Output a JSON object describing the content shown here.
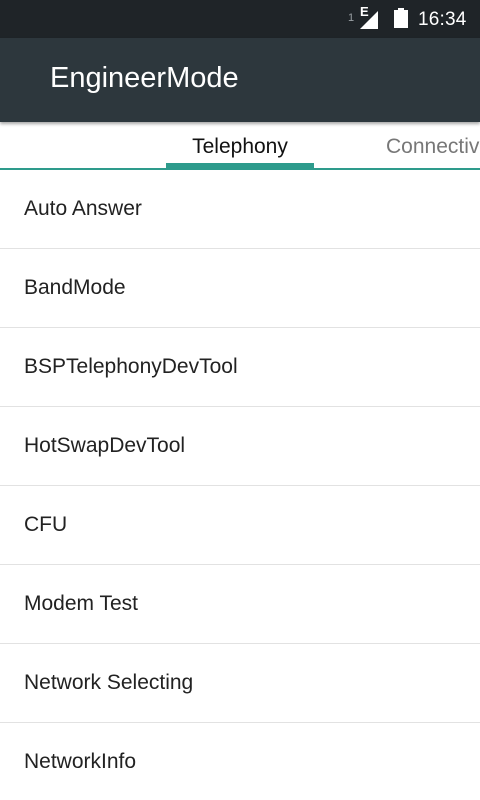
{
  "status_bar": {
    "sim_slot": "1",
    "network_type": "E",
    "time": "16:34",
    "icons": [
      "signal-icon",
      "battery-icon"
    ]
  },
  "app_bar": {
    "title": "EngineerMode"
  },
  "tabs": [
    {
      "label": "Telephony",
      "selected": true
    },
    {
      "label": "Connectiv",
      "selected": false
    }
  ],
  "list": {
    "items": [
      {
        "label": "Auto Answer"
      },
      {
        "label": "BandMode"
      },
      {
        "label": "BSPTelephonyDevTool"
      },
      {
        "label": "HotSwapDevTool"
      },
      {
        "label": "CFU"
      },
      {
        "label": "Modem Test"
      },
      {
        "label": "Network Selecting"
      },
      {
        "label": "NetworkInfo"
      }
    ]
  },
  "colors": {
    "status_bar_bg": "#1f2428",
    "app_bar_bg": "#2d373d",
    "accent": "#2e9b8c",
    "divider": "#e2e2e2"
  }
}
